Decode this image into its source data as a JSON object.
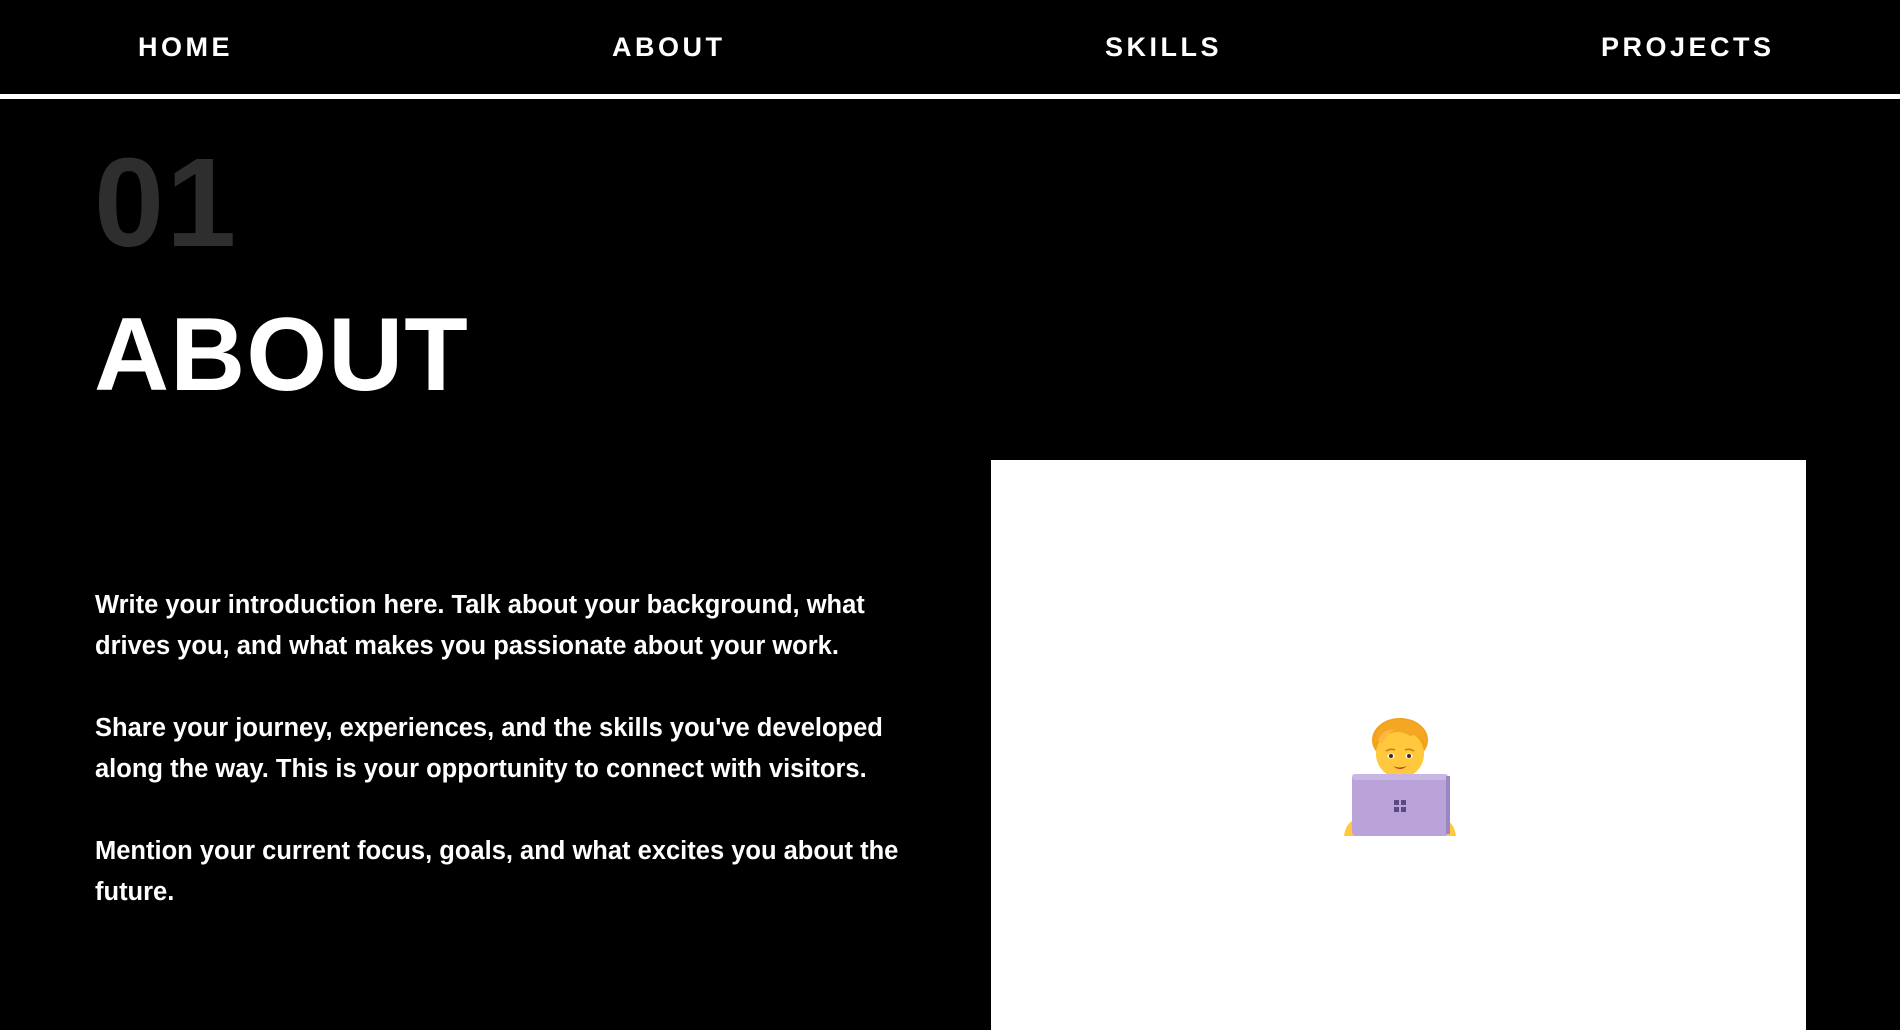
{
  "nav": {
    "items": [
      {
        "label": "HOME"
      },
      {
        "label": "ABOUT"
      },
      {
        "label": "SKILLS"
      },
      {
        "label": "PROJECTS"
      }
    ]
  },
  "section": {
    "number": "01",
    "title": "ABOUT",
    "paragraphs": [
      "Write your introduction here. Talk about your background, what drives you, and what makes you passionate about your work.",
      "Share your journey, experiences, and the skills you've developed along the way. This is your opportunity to connect with visitors.",
      "Mention your current focus, goals, and what excites you about the future."
    ]
  },
  "image": {
    "icon": "technologist-emoji-icon"
  },
  "colors": {
    "background": "#000000",
    "text": "#ffffff",
    "section_number": "#2e2e2e",
    "panel": "#ffffff",
    "laptop": "#b9a3d8",
    "hair": "#f5a623",
    "skin": "#ffc83d"
  }
}
